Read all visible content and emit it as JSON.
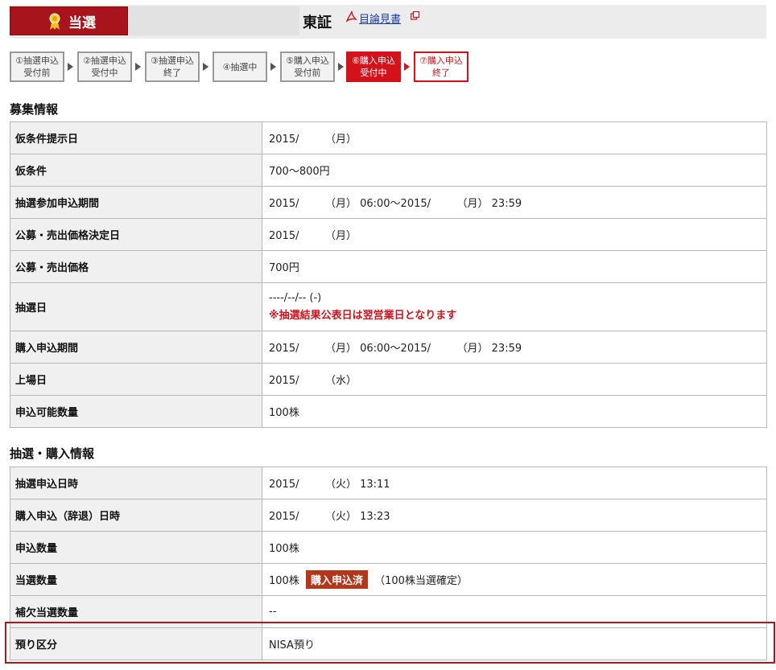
{
  "header": {
    "badge_label": "当選",
    "market": "東証",
    "prospectus_link": "目論見書",
    "icons": {
      "badge": "medal-icon",
      "pdf": "pdf-icon",
      "external": "external-link-icon"
    }
  },
  "steps": [
    {
      "label": "①抽選申込\n受付前",
      "state": "done"
    },
    {
      "label": "②抽選申込\n受付中",
      "state": "done"
    },
    {
      "label": "③抽選申込\n終了",
      "state": "done"
    },
    {
      "label": "④抽選中",
      "state": "done"
    },
    {
      "label": "⑤購入申込\n受付前",
      "state": "done"
    },
    {
      "label": "⑥購入申込\n受付中",
      "state": "active"
    },
    {
      "label": "⑦購入申込\n終了",
      "state": "next"
    }
  ],
  "recruit": {
    "title": "募集情報",
    "rows": [
      {
        "key": "仮条件提示日",
        "value": "2015/　　　（月）"
      },
      {
        "key": "仮条件",
        "value": "700～800円"
      },
      {
        "key": "抽選参加申込期間",
        "value": "2015/　　　（月） 06:00～2015/　　　（月） 23:59"
      },
      {
        "key": "公募・売出価格決定日",
        "value": "2015/　　　（月）"
      },
      {
        "key": "公募・売出価格",
        "value": "700円"
      },
      {
        "key": "抽選日",
        "value": "----/--/-- (-)",
        "note": "※抽選結果公表日は翌営業日となります"
      },
      {
        "key": "購入申込期間",
        "value": "2015/　　　（月） 06:00～2015/　　　（月） 23:59"
      },
      {
        "key": "上場日",
        "value": "2015/　　　（水）"
      },
      {
        "key": "申込可能数量",
        "value": "100株"
      }
    ]
  },
  "lottery": {
    "title": "抽選・購入情報",
    "rows": [
      {
        "key": "抽選申込日時",
        "value": "2015/　　　（火） 13:11"
      },
      {
        "key": "購入申込（辞退）日時",
        "value": "2015/　　　（火） 13:23"
      },
      {
        "key": "申込数量",
        "value": "100株"
      },
      {
        "key": "当選数量",
        "value": "100株",
        "tag": "購入申込済",
        "suffix": "（100株当選確定）"
      },
      {
        "key": "補欠当選数量",
        "value": "--"
      },
      {
        "key": "預り区分",
        "value": "NISA預り"
      }
    ]
  },
  "colors": {
    "accent_red": "#d3121b",
    "badge_red": "#a8141c",
    "tag_brown": "#b3361b"
  }
}
